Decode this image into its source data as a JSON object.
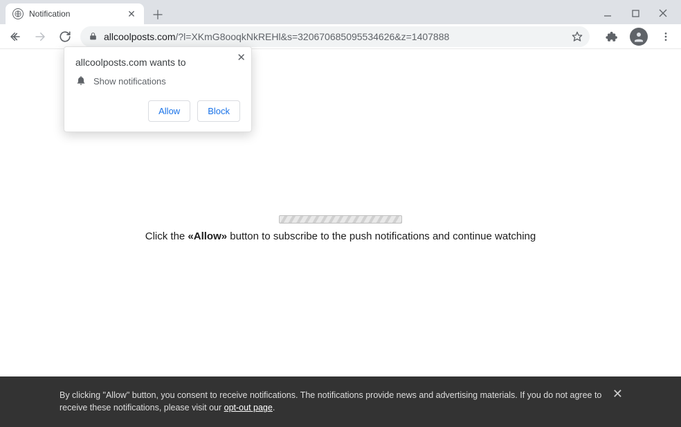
{
  "window": {
    "tab_title": "Notification"
  },
  "url": {
    "host": "allcoolposts.com",
    "path": "/?l=XKmG8ooqkNkREHl&s=320670685095534626&z=1407888"
  },
  "permission": {
    "title": "allcoolposts.com wants to",
    "item": "Show notifications",
    "allow": "Allow",
    "block": "Block"
  },
  "page": {
    "msg_pre": "Click the ",
    "msg_bold": "«Allow»",
    "msg_post": " button to subscribe to the push notifications and continue watching"
  },
  "cookies": {
    "text_1": "By clicking \"Allow\" button, you consent to receive notifications. The notifications provide news and advertising materials. If you do not agree to receive these notifications, please visit our ",
    "link": "opt-out page",
    "text_2": "."
  }
}
